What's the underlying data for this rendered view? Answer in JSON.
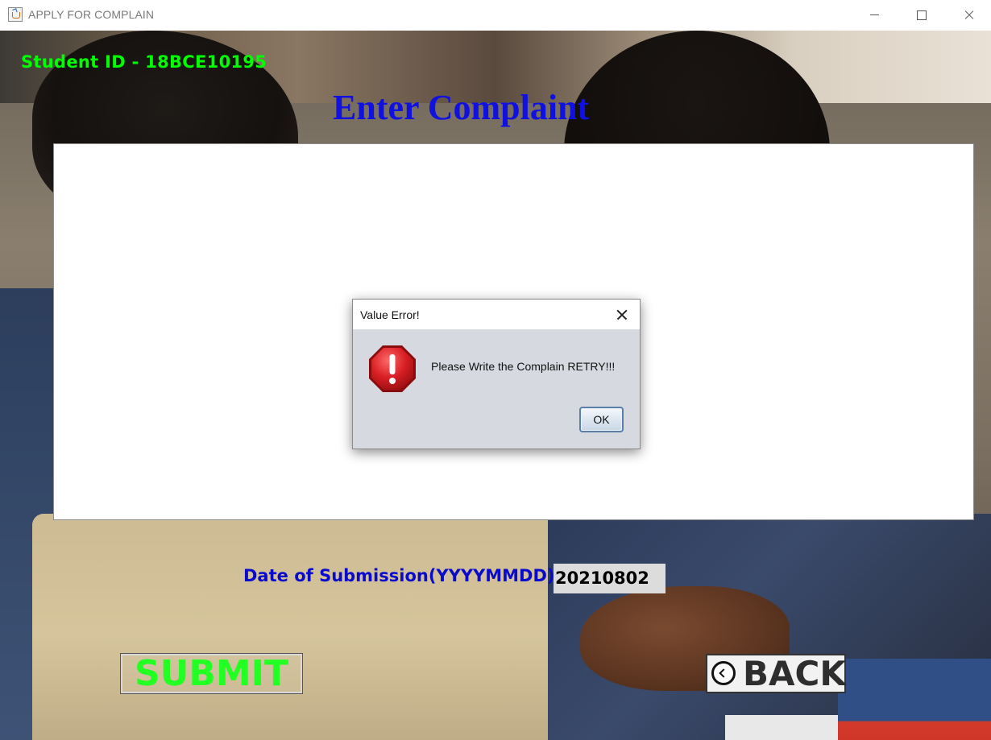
{
  "window": {
    "title": "APPLY FOR COMPLAIN"
  },
  "form": {
    "student_id": "Student ID - 18BCE10195",
    "heading": "Enter Complaint",
    "complaint_text": "",
    "date_label": "Date of Submission(YYYYMMDD)",
    "date_value": "20210802",
    "submit_label": "SUBMIT",
    "back_label": "BACK"
  },
  "dialog": {
    "title": "Value Error!",
    "message": "Please Write the Complain RETRY!!!",
    "ok_label": "OK",
    "icon": "error-octagon-icon"
  },
  "colors": {
    "student_id": "#00ff00",
    "heading": "#1010e0",
    "date_label": "#0a0acc",
    "submit_text": "#22ff22",
    "error_red": "#d4252b"
  }
}
